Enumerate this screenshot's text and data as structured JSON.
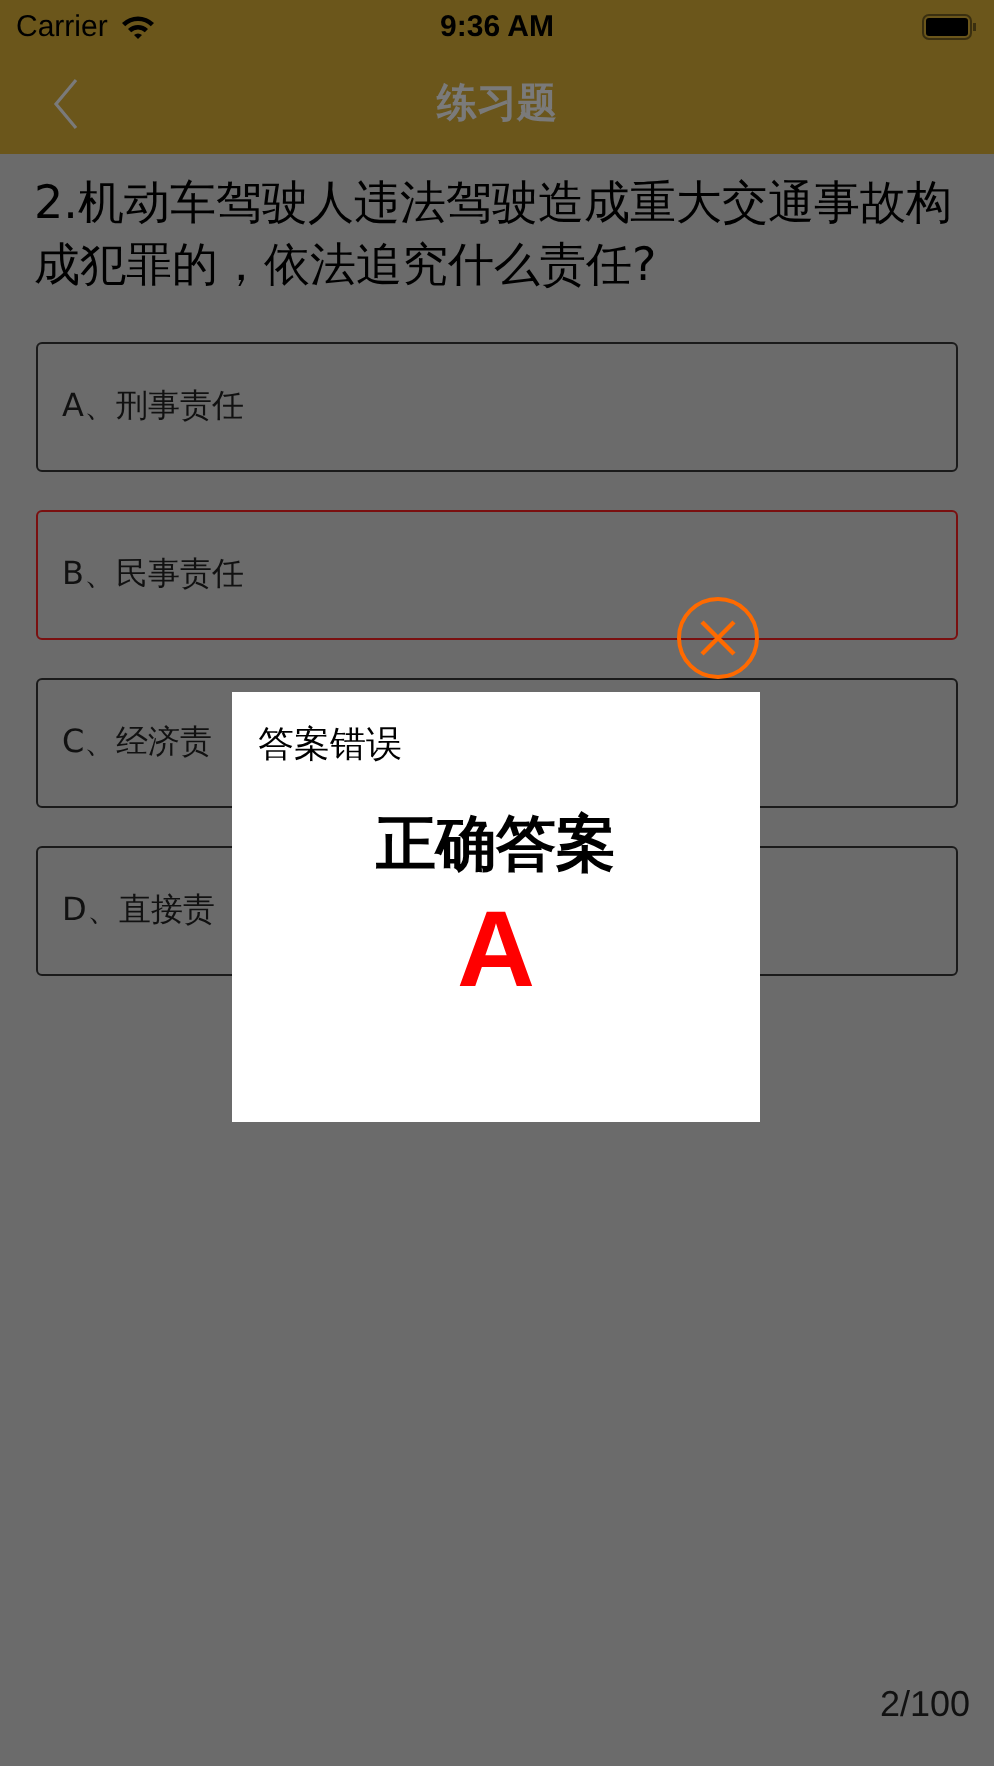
{
  "status_bar": {
    "carrier": "Carrier",
    "time": "9:36 AM"
  },
  "nav": {
    "title": "练习题"
  },
  "question": "2.机动车驾驶人违法驾驶造成重大交通事故构成犯罪的，依法追究什么责任?",
  "options": [
    {
      "label": "A、刑事责任",
      "selected": false
    },
    {
      "label": "B、民事责任",
      "selected": true
    },
    {
      "label": "C、经济责",
      "selected": false
    },
    {
      "label": "D、直接责",
      "selected": false
    }
  ],
  "dialog": {
    "title": "答案错误",
    "heading": "正确答案",
    "answer": "A"
  },
  "progress": "2/100"
}
